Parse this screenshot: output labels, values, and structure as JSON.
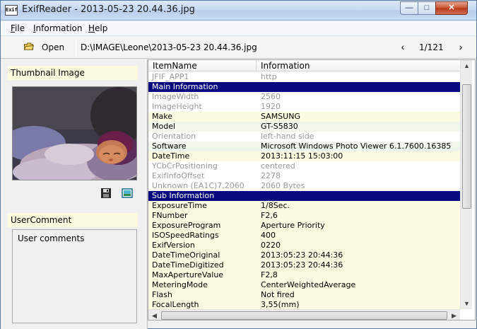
{
  "window": {
    "title": "ExifReader - 2013-05-23 20.44.36.jpg",
    "app_icon_text": "Exif",
    "minimize": "—",
    "maximize": "□",
    "close": "✕"
  },
  "menu": [
    {
      "underline": "F",
      "rest": "ile"
    },
    {
      "underline": "I",
      "rest": "nformation"
    },
    {
      "underline": "H",
      "rest": "elp"
    }
  ],
  "toolbar": {
    "open_label": "Open",
    "path": "D:\\IMAGE\\Leone\\2013-05-23 20.44.36.jpg",
    "prev": "‹",
    "page": "1/121",
    "next": "›"
  },
  "left": {
    "thumbnail_header": "Thumbnail Image",
    "comment_header": "UserComment",
    "comment_text": "User comments"
  },
  "list": {
    "col_item": "ItemName",
    "col_info": "Information",
    "rows": [
      {
        "name": "JFIF_APP1",
        "info": "http",
        "style": "dim"
      },
      {
        "name": "Main Information",
        "info": "",
        "style": "section"
      },
      {
        "name": "ImageWidth",
        "info": "2560",
        "style": "dim"
      },
      {
        "name": "ImageHeight",
        "info": "1920",
        "style": "dim"
      },
      {
        "name": "Make",
        "info": "SAMSUNG",
        "style": "even"
      },
      {
        "name": "Model",
        "info": "GT-S5830",
        "style": "alt2"
      },
      {
        "name": "Orientation",
        "info": "left-hand side",
        "style": "dim"
      },
      {
        "name": "Software",
        "info": "Microsoft Windows Photo Viewer 6.1.7600.16385",
        "style": "alt2"
      },
      {
        "name": "DateTime",
        "info": "2013:11:15 15:03:00",
        "style": "even"
      },
      {
        "name": "YCbCrPositioning",
        "info": "centered",
        "style": "dim"
      },
      {
        "name": "ExifInfoOffset",
        "info": "2278",
        "style": "dim"
      },
      {
        "name": "Unknown (EA1C)7,2060",
        "info": "2060 Bytes",
        "style": "dim"
      },
      {
        "name": "Sub Information",
        "info": "",
        "style": "section"
      },
      {
        "name": "ExposureTime",
        "info": "1/8Sec.",
        "style": "even"
      },
      {
        "name": "FNumber",
        "info": "F2,6",
        "style": "even"
      },
      {
        "name": "ExposureProgram",
        "info": "Aperture Priority",
        "style": "even"
      },
      {
        "name": "ISOSpeedRatings",
        "info": "400",
        "style": "even"
      },
      {
        "name": "ExifVersion",
        "info": "0220",
        "style": "even"
      },
      {
        "name": "DateTimeOriginal",
        "info": "2013:05:23 20:44:36",
        "style": "even"
      },
      {
        "name": "DateTimeDigitized",
        "info": "2013:05:23 20:44:36",
        "style": "even"
      },
      {
        "name": "MaxApertureValue",
        "info": "F2,8",
        "style": "even"
      },
      {
        "name": "MeteringMode",
        "info": "CenterWeightedAverage",
        "style": "even"
      },
      {
        "name": "Flash",
        "info": "Not fired",
        "style": "even"
      },
      {
        "name": "FocalLength",
        "info": "3,55(mm)",
        "style": "even"
      }
    ]
  },
  "colors": {
    "section_bg": "#0a0a80",
    "row_yellow": "#fbfbe2",
    "row_green": "#f0f6eb",
    "dim_text": "#9a9a9a"
  }
}
